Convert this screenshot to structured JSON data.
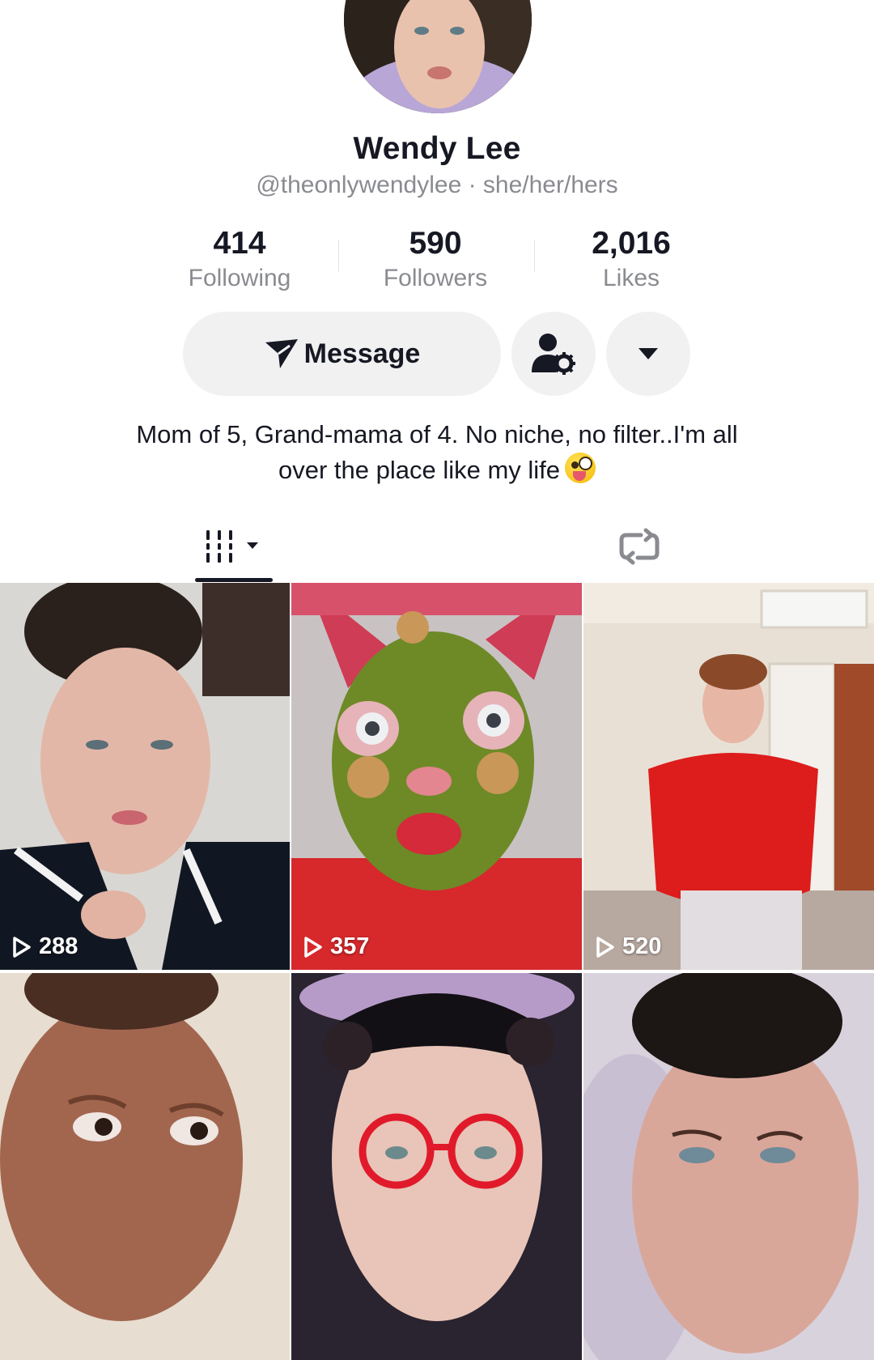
{
  "profile": {
    "name": "Wendy Lee",
    "handle": "@theonlywendylee · she/her/hers",
    "bio_line1": "Mom of 5, Grand-mama of 4. No niche, no filter..I'm all",
    "bio_line2": "over the place like my life",
    "bio_emoji": "zany-face-emoji"
  },
  "stats": [
    {
      "value": "414",
      "label": "Following"
    },
    {
      "value": "590",
      "label": "Followers"
    },
    {
      "value": "2,016",
      "label": "Likes"
    }
  ],
  "actions": {
    "message_label": "Message",
    "message_icon": "send-arrow-icon",
    "friend_settings_icon": "person-gear-icon",
    "more_icon": "caret-down-icon"
  },
  "tabs": [
    {
      "name": "videos",
      "icon": "grid-bars-icon",
      "active": true
    },
    {
      "name": "reposts",
      "icon": "repost-icon",
      "active": false
    }
  ],
  "videos": [
    {
      "views": "288"
    },
    {
      "views": "357"
    },
    {
      "views": "520"
    },
    {
      "views": ""
    },
    {
      "views": ""
    },
    {
      "views": ""
    }
  ],
  "colors": {
    "text": "#161823",
    "muted": "#8a8b91",
    "button_bg": "#f1f1f2"
  }
}
